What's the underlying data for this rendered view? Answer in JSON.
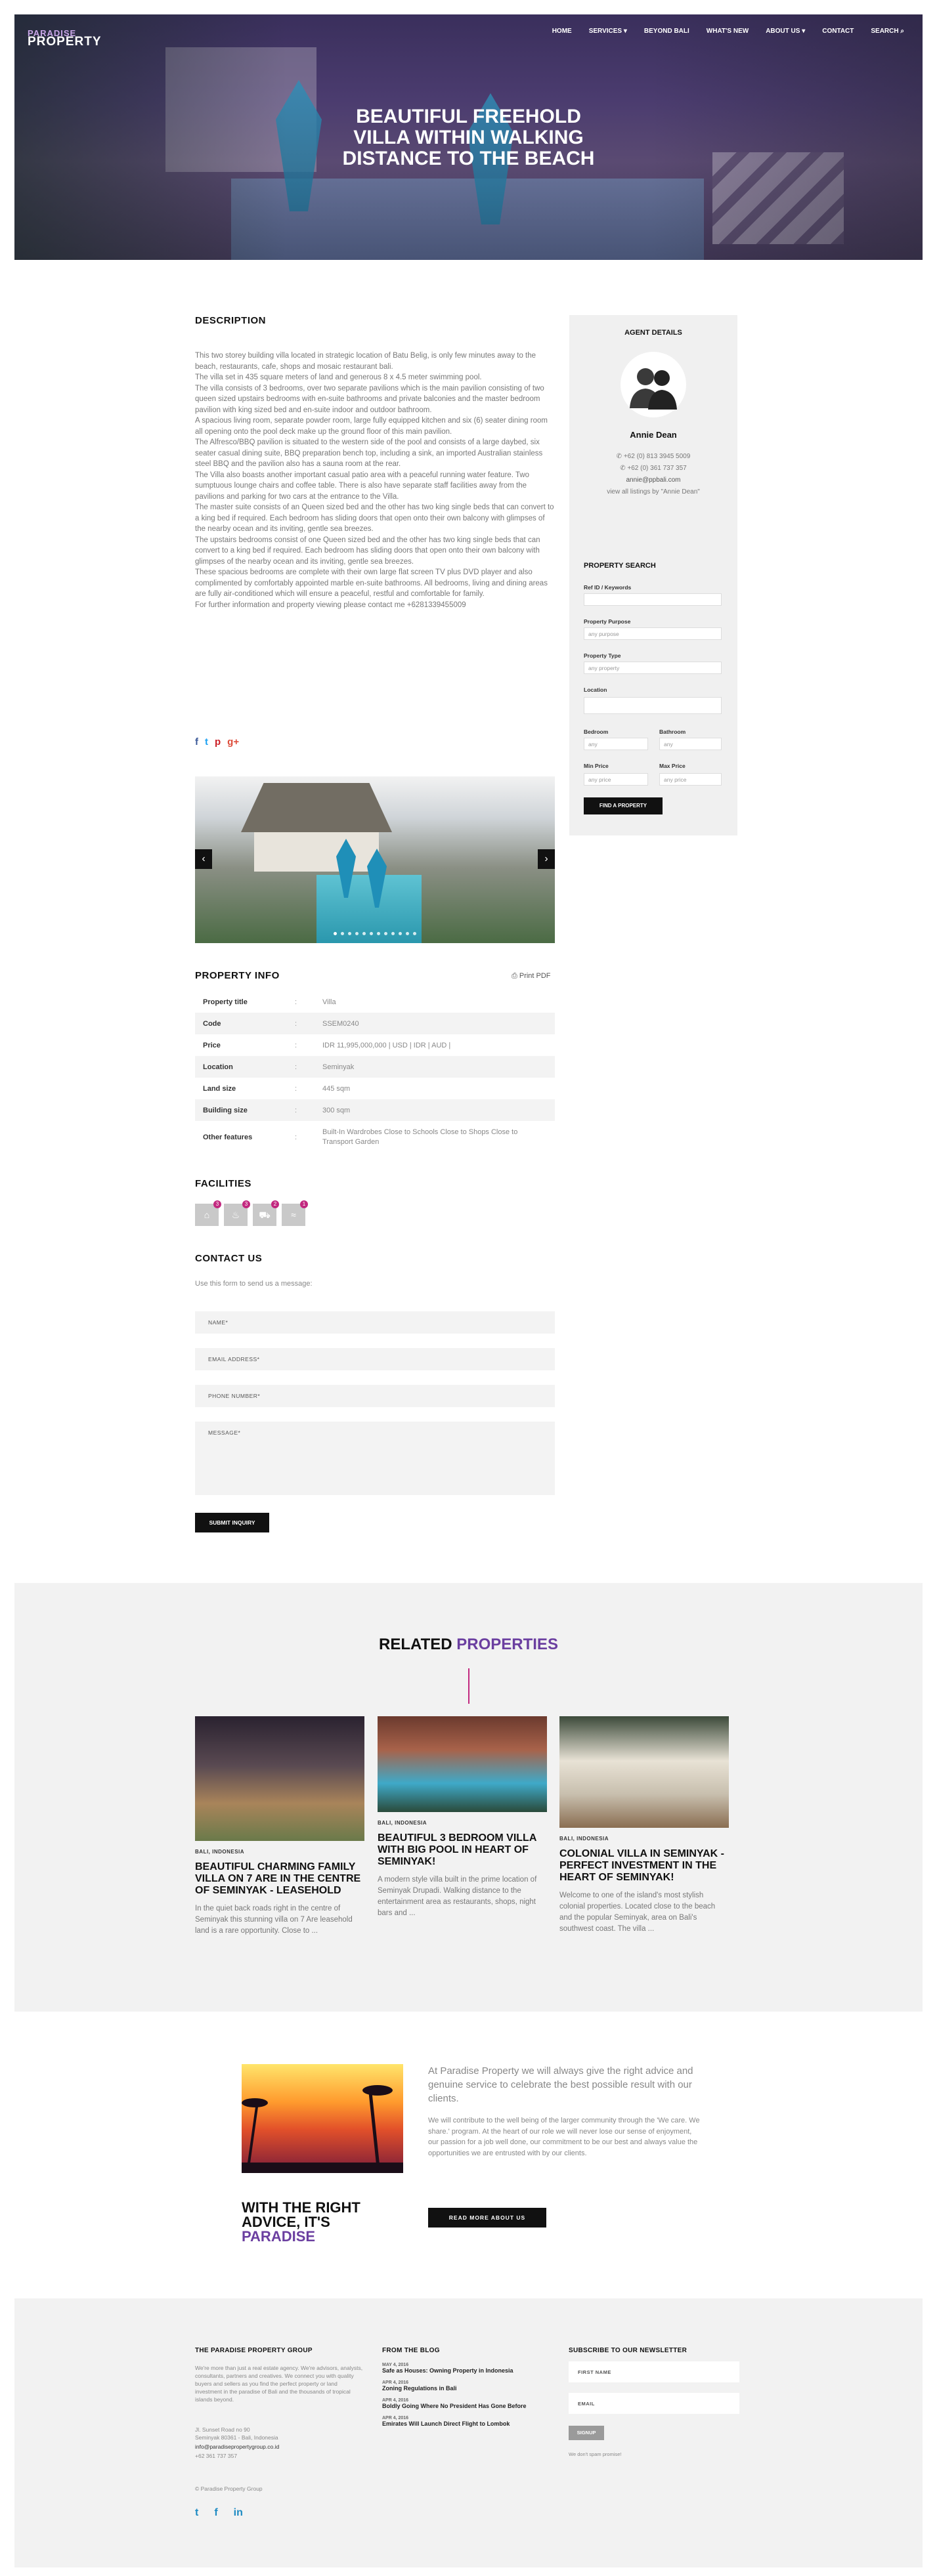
{
  "header": {
    "logo_line1": "PARADISE",
    "logo_line2": "PROPERTY",
    "nav": [
      "HOME",
      "SERVICES ▾",
      "BEYOND BALI",
      "WHAT'S NEW",
      "ABOUT US ▾",
      "CONTACT",
      "SEARCH"
    ],
    "hero_title": "BEAUTIFUL FREEHOLD VILLA WITHIN WALKING DISTANCE TO THE BEACH"
  },
  "description": {
    "title": "DESCRIPTION",
    "paragraphs": [
      "This two storey building villa located in strategic location of Batu Belig, is only few minutes away to the beach, restaurants, cafe, shops and mosaic restaurant bali.",
      "The villa set in 435 square meters of land and generous 8 x 4.5 meter swimming pool.",
      "The villa consists of 3 bedrooms, over two separate pavilions which is the main pavilion consisting of two queen sized upstairs bedrooms with en-suite bathrooms and private balconies and the master bedroom pavilion with king sized bed and en-suite indoor and outdoor bathroom.",
      "A spacious living room, separate powder room, large fully equipped kitchen and six (6) seater dining room all opening onto the pool deck make up the ground floor of this main pavilion.",
      "The Alfresco/BBQ pavilion is situated to the western side of the pool and consists of a large daybed, six seater casual dining suite, BBQ preparation bench top, including a sink, an imported Australian stainless steel BBQ and the pavilion also has a sauna room at the rear.",
      "The Villa also boasts another important casual patio area with a peaceful running water feature. Two sumptuous lounge chairs and coffee table. There is also have separate staff facilities away from the pavilions and parking for two cars at the entrance to the Villa.",
      "The master suite consists of an Queen sized bed and the other has two king single beds that can convert to a king bed if required. Each bedroom has sliding doors that open onto their own balcony with glimpses of the nearby ocean and its inviting, gentle sea breezes.",
      "The upstairs bedrooms consist of one Queen sized bed and the other has two king single beds that can convert to a king bed if required. Each bedroom has sliding doors that open onto their own balcony with glimpses of the nearby ocean and its inviting, gentle sea breezes.",
      "These spacious bedrooms are complete with their own large flat screen TV plus DVD player and also complimented by comfortably appointed marble en-suite bathrooms. All bedrooms, living and dining areas are fully air-conditioned which will ensure a peaceful, restful and comfortable for family.",
      "For further information and property viewing please contact me +6281339455009"
    ]
  },
  "share": [
    "f",
    "t",
    "p",
    "g+"
  ],
  "slider": {
    "prev": "‹",
    "next": "›",
    "dots": 12
  },
  "property_info": {
    "title": "PROPERTY INFO",
    "print": "⎙ Print PDF",
    "rows": [
      {
        "k": "Property title",
        "v": "Villa"
      },
      {
        "k": "Code",
        "v": "SSEM0240"
      },
      {
        "k": "Price",
        "v": "IDR 11,995,000,000 | USD | IDR | AUD |"
      },
      {
        "k": "Location",
        "v": "Seminyak"
      },
      {
        "k": "Land size",
        "v": "445 sqm"
      },
      {
        "k": "Building size",
        "v": "300 sqm"
      },
      {
        "k": "Other features",
        "v": "Built-In Wardrobes Close to Schools Close to Shops Close to Transport Garden"
      }
    ]
  },
  "facilities": {
    "title": "FACILITIES",
    "items": [
      {
        "icon": "bed-icon",
        "glyph": "⌂",
        "count": "3"
      },
      {
        "icon": "bath-icon",
        "glyph": "♨",
        "count": "3"
      },
      {
        "icon": "car-icon",
        "glyph": "⛟",
        "count": "2"
      },
      {
        "icon": "pool-icon",
        "glyph": "≈",
        "count": "1"
      }
    ]
  },
  "contact": {
    "title": "CONTACT US",
    "sub": "Use this form to send us a message:",
    "name": "NAME*",
    "email": "EMAIL ADDRESS*",
    "phone": "PHONE NUMBER*",
    "message": "MESSAGE*",
    "submit": "SUBMIT INQUIRY"
  },
  "agent": {
    "title": "AGENT DETAILS",
    "name": "Annie Dean",
    "phone1": "✆ +62 (0) 813 3945 5009",
    "phone2": "✆ +62 (0) 361 737 357",
    "email": "annie@ppbali.com",
    "listings": "view all listings by \"Annie Dean\""
  },
  "search": {
    "title": "PROPERTY SEARCH",
    "ref_label": "Ref ID / Keywords",
    "purpose_label": "Property Purpose",
    "purpose_value": "any purpose",
    "type_label": "Property Type",
    "type_value": "any property",
    "location_label": "Location",
    "bedroom_label": "Bedroom",
    "bedroom_value": "any",
    "bathroom_label": "Bathroom",
    "bathroom_value": "any",
    "min_label": "Min Price",
    "min_value": "any price",
    "max_label": "Max Price",
    "max_value": "any price",
    "button": "FIND A PROPERTY"
  },
  "related": {
    "title_black": "RELATED ",
    "title_accent": "PROPERTIES",
    "cards": [
      {
        "tag": "BALI, INDONESIA",
        "title": "BEAUTIFUL CHARMING FAMILY VILLA ON 7 ARE IN THE CENTRE OF SEMINYAK - LEASEHOLD",
        "desc": "In the quiet back roads right in the centre of Seminyak this stunning villa on 7 Are leasehold land is a rare opportunity. Close to ..."
      },
      {
        "tag": "BALI, INDONESIA",
        "title": "BEAUTIFUL 3 BEDROOM VILLA WITH BIG POOL IN HEART OF SEMINYAK!",
        "desc": "A modern style villa built in the prime location of Seminyak Drupadi. Walking distance to the entertainment area as restaurants, shops, night bars and ..."
      },
      {
        "tag": "BALI, INDONESIA",
        "title": "COLONIAL VILLA IN SEMINYAK - PERFECT INVESTMENT IN THE HEART OF SEMINYAK!",
        "desc": "Welcome to one of the island's most stylish colonial properties. Located close to the beach and the popular Seminyak, area on Bali's southwest coast. The villa ..."
      }
    ]
  },
  "about": {
    "heading_1": "WITH THE RIGHT",
    "heading_2": "ADVICE, IT'S",
    "heading_accent": "PARADISE",
    "lead": "At Paradise Property we will always give the right advice and genuine service to celebrate the best possible result with our clients.",
    "body": "We will contribute to the well being of the larger community through the 'We care. We share.' program. At the heart of our role we will never lose our sense of enjoyment, our passion for a job well done, our commitment to be our best and always value the opportunities we are entrusted with by our clients.",
    "button": "READ MORE ABOUT US"
  },
  "footer": {
    "group_title": "THE PARADISE PROPERTY GROUP",
    "group_text": "We're more than just a real estate agency. We're advisors, analysts, consultants, partners and creatives. We connect you with quality buyers and sellers as you find the perfect property or land investment in the paradise of Bali and the thousands of tropical islands beyond.",
    "address1": "Jl. Sunset Road no 90",
    "address2": "Seminyak 80361 - Bali, Indonesia",
    "email": "info@paradisepropertygroup.co.id",
    "phone": "+62 361 737 357",
    "copyright": "© Paradise Property Group",
    "blog_title": "FROM THE BLOG",
    "blog": [
      {
        "date": "MAY 4, 2016",
        "title": "Safe as Houses: Owning Property in Indonesia"
      },
      {
        "date": "APR 4, 2016",
        "title": "Zoning Regulations in Bali"
      },
      {
        "date": "APR 4, 2016",
        "title": "Boldly Going Where No President Has Gone Before"
      },
      {
        "date": "APR 4, 2016",
        "title": "Emirates Will Launch Direct Flight to Lombok"
      }
    ],
    "newsletter_title": "SUBSCRIBE TO OUR NEWSLETTER",
    "first_name": "FIRST NAME",
    "email_field": "EMAIL",
    "signup": "SIGNUP",
    "no_spam": "We don't spam promise!",
    "socials": [
      "t",
      "f",
      "in"
    ]
  },
  "colors": {
    "accent": "#6b3fa0",
    "pink": "#c2287f",
    "dark": "#111111",
    "light_bg": "#f2f2f2"
  }
}
